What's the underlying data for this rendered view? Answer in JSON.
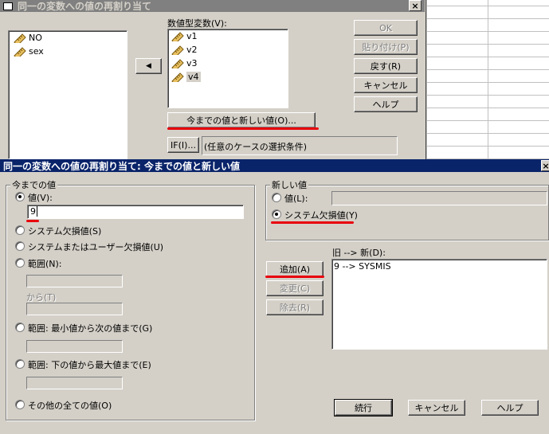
{
  "dialog1": {
    "title": "同一の変数への値の再割り当て",
    "close_glyph": "×",
    "source_vars": [
      "NO",
      "sex"
    ],
    "numeric_label": "数値型変数(V):",
    "numeric_vars": [
      "v1",
      "v2",
      "v3",
      "v4"
    ],
    "move_glyph": "◀",
    "old_new_button": "今までの値と新しい値(O)...",
    "if_button": "IF(I)...",
    "if_text": "(任意のケースの選択条件)",
    "buttons": {
      "ok": "OK",
      "paste": "貼り付け(P)",
      "reset": "戻す(R)",
      "cancel": "キャンセル",
      "help": "ヘルプ"
    }
  },
  "dialog2": {
    "title": "同一の変数への値の再割り当て: 今までの値と新しい値",
    "old_value": {
      "group_label": "今までの値",
      "value_label": "値(V):",
      "value_input": "9",
      "system_missing": "システム欠損値(S)",
      "system_or_user_missing": "システムまたはユーザー欠損値(U)",
      "range": "範囲(N):",
      "through": "から(T)",
      "range_lowest": "範囲: 最小値から次の値まで(G)",
      "range_highest": "範囲: 下の値から最大値まで(E)",
      "all_other": "その他の全ての値(O)"
    },
    "new_value": {
      "group_label": "新しい値",
      "value_label": "値(L):",
      "system_missing": "システム欠損値(Y)"
    },
    "mapping_label": "旧 --> 新(D):",
    "mappings": [
      "9 --> SYSMIS"
    ],
    "buttons": {
      "add": "追加(A)",
      "change": "変更(C)",
      "remove": "除去(R)",
      "continue": "続行",
      "cancel": "キャンセル",
      "help": "ヘルプ"
    }
  },
  "colors": {
    "title_active": "#0a246a",
    "title_inactive": "#808080",
    "annotation": "#e8000c",
    "dialog_face": "#d4d0c8"
  }
}
